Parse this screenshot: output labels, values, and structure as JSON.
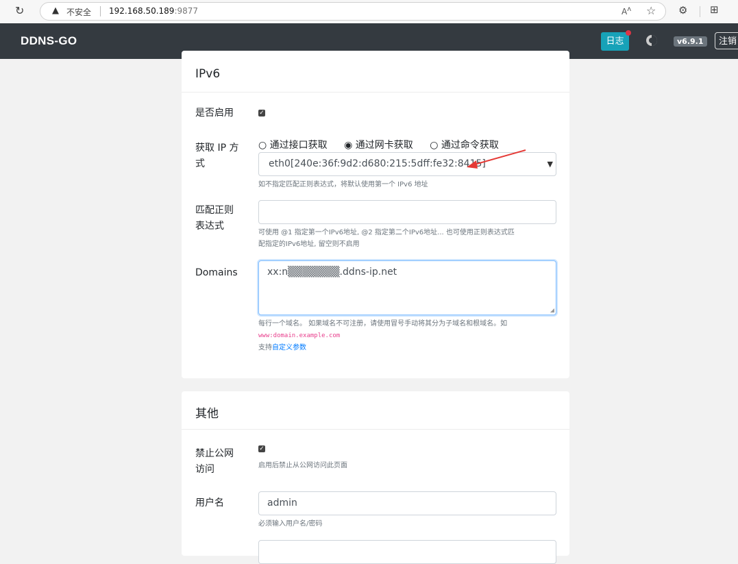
{
  "browser": {
    "security_label": "不安全",
    "url_host": "192.168.50.189",
    "url_port": ":9877"
  },
  "navbar": {
    "brand": "DDNS-GO",
    "log_label": "日志",
    "version": "v6.9.1",
    "logout_label": "注销"
  },
  "ipv6": {
    "title": "IPv6",
    "enable_label": "是否启用",
    "enabled": true,
    "get_ip_label_line1": "获取 IP 方",
    "get_ip_label_line2": "式",
    "methods": [
      "通过接口获取",
      "通过网卡获取",
      "通过命令获取"
    ],
    "selected_method": "通过网卡获取",
    "interface_value": "eth0[240e:36f:9d2:d680:215:5dff:fe32:8415]",
    "interface_help": "如不指定匹配正则表达式，将默认使用第一个 IPv6 地址",
    "regex_label_line1": "匹配正则",
    "regex_label_line2": "表达式",
    "regex_value": "",
    "regex_help_line1": "可使用 @1 指定第一个IPv6地址, @2 指定第二个IPv6地址... 也可使用正则表达式匹",
    "regex_help_line2": "配指定的IPv6地址, 留空则不启用",
    "domains_label": "Domains",
    "domains_value": "xx:n▒▒▒▒▒▒▒.ddns-ip.net",
    "domains_help_line1": "每行一个域名。 如果域名不可注册，请使用冒号手动将其分为子域名和根域名。如",
    "domains_help_example": "www:domain.example.com",
    "domains_help_prefix": "支持",
    "domains_help_link": "自定义参数"
  },
  "other": {
    "title": "其他",
    "block_public_label_line1": "禁止公网",
    "block_public_label_line2": "访问",
    "block_public": true,
    "block_public_help": "启用后禁止从公网访问此页面",
    "username_label": "用户名",
    "username_value": "admin",
    "username_help": "必须输入用户名/密码"
  },
  "colors": {
    "navbar": "#343a40",
    "log_button": "#17a2b8",
    "link": "#007bff",
    "code": "#e83e8c",
    "annotation_arrow": "#e53935"
  }
}
